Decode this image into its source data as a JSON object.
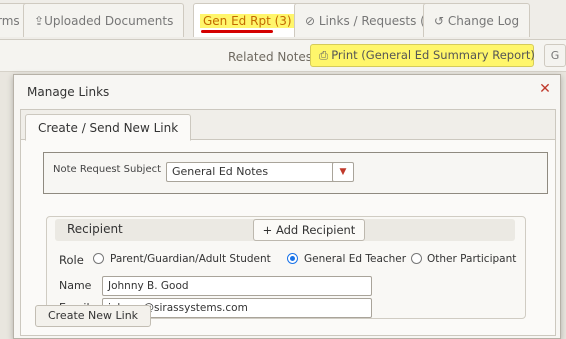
{
  "tabs": [
    {
      "label": "rms"
    },
    {
      "label": "Uploaded Documents",
      "icon": "upload-icon"
    },
    {
      "label": "Gen Ed Rpt (3)"
    },
    {
      "label": "Links / Requests (6)",
      "icon": "link-icon"
    },
    {
      "label": "Change Log",
      "icon": "history-icon"
    }
  ],
  "subbar": {
    "related_notes": "Related Notes",
    "print_label": "Print (General Ed Summary Report)",
    "extra": "G"
  },
  "modal": {
    "title": "Manage Links",
    "tab": "Create / Send New Link",
    "subject_label": "Note Request Subject",
    "subject_value": "General Ed Notes",
    "recipient_label": "Recipient",
    "add_recipient": "+ Add Recipient",
    "role_label": "Role",
    "roles": [
      "Parent/Guardian/Adult Student",
      "General Ed Teacher",
      "Other Participant"
    ],
    "selected_role": "General Ed Teacher",
    "name_label": "Name",
    "name_value": "Johnny B. Good",
    "email_label": "Email",
    "email_value": "johnny@sirassystems.com",
    "create_button": "Create New Link"
  },
  "colors": {
    "highlight": "#fff66b",
    "underline": "#d40000",
    "close": "#c0392b",
    "radio_selected": "#1a73e8"
  }
}
